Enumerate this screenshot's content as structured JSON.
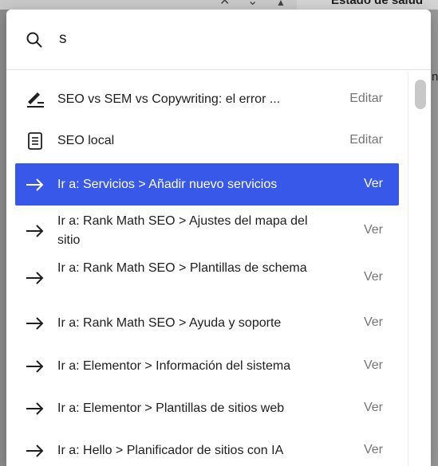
{
  "background": {
    "panel_title": "Estado de salud",
    "right_letter": "n"
  },
  "search": {
    "icon": "search-icon",
    "query": "s"
  },
  "results": [
    {
      "icon": "post-icon",
      "label": "SEO vs SEM vs Copywriting: el error ...",
      "action": "Editar"
    },
    {
      "icon": "page-icon",
      "label": "SEO local",
      "action": "Editar"
    },
    {
      "icon": "arrow-right-icon",
      "label": "Ir a: Servicios > Añadir nuevo servicios",
      "action": "Ver",
      "selected": true
    },
    {
      "icon": "arrow-right-icon",
      "label": "Ir a: Rank Math SEO > Ajustes del mapa del sitio",
      "action": "Ver"
    },
    {
      "icon": "arrow-right-icon",
      "label": "Ir a: Rank Math SEO > Plantillas de schema",
      "action": "Ver"
    },
    {
      "icon": "arrow-right-icon",
      "label": "Ir a: Rank Math SEO > Ayuda y soporte",
      "action": "Ver"
    },
    {
      "icon": "arrow-right-icon",
      "label": "Ir a: Elementor > Información del sistema",
      "action": "Ver"
    },
    {
      "icon": "arrow-right-icon",
      "label": "Ir a: Elementor > Plantillas de sitios web",
      "action": "Ver"
    },
    {
      "icon": "arrow-right-icon",
      "label": "Ir a: Hello > Planificador de sitios con IA",
      "action": "Ver"
    }
  ],
  "colors": {
    "selected_bg": "#3858e9",
    "action_text": "#757575"
  }
}
